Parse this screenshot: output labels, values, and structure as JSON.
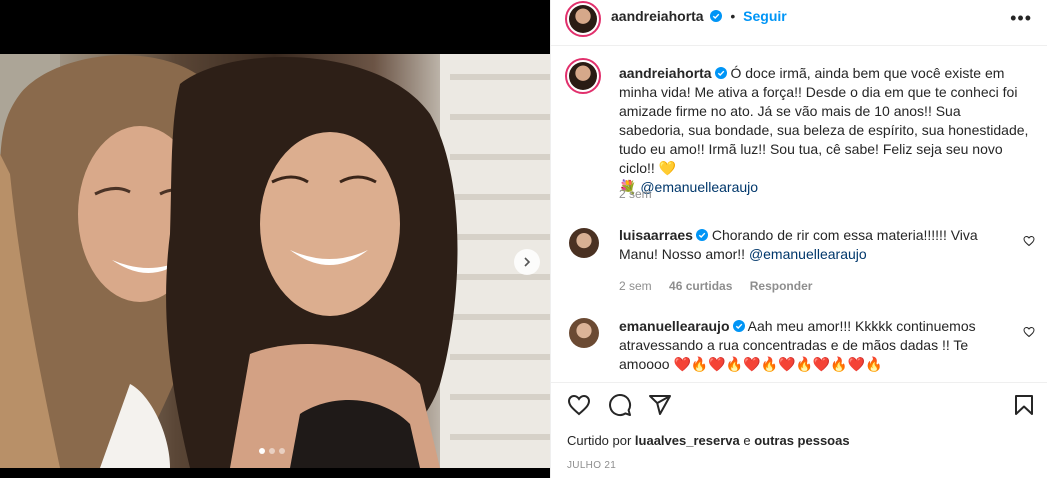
{
  "post": {
    "username": "aandreiahorta",
    "follow_label": "Seguir",
    "separator": "•",
    "more_label": "•••",
    "caption": {
      "username": "aandreiahorta",
      "text": " Ó doce irmã, ainda bem que você existe em minha vida! Me ativa a força!! Desde o dia em que te conheci foi amizade firme no ato. Já se vão mais de 10 anos!! Sua sabedoria, sua bondade, sua beleza de espírito, sua honestidade, tudo eu amo!! Irmã luz!! Sou tua, cê sabe! Feliz seja seu novo ciclo!! 💛",
      "emoji_line": "💐",
      "mention": "@emanuellearaujo",
      "time": "2 sem"
    },
    "comments": [
      {
        "username": "luisaarraes",
        "text": " Chorando de rir com essa materia!!!!!! Viva Manu! Nosso amor!! ",
        "mention": "@emanuellearaujo",
        "time": "2 sem",
        "likes": "46 curtidas",
        "reply": "Responder"
      },
      {
        "username": "emanuellearaujo",
        "text": " Aah meu amor!!! Kkkkk continuemos atravessando a rua concentradas e de mãos dadas !! Te amoooo ❤️🔥❤️🔥❤️🔥❤️🔥❤️🔥❤️🔥"
      }
    ],
    "liked_by": {
      "prefix": "Curtido por ",
      "user": "luaalves_reserva",
      "joiner": " e ",
      "others": "outras pessoas"
    },
    "date": "JULHO 21",
    "carousel": {
      "count": 3,
      "active": 0
    }
  },
  "colors": {
    "follow": "#0095f6",
    "mention": "#00376b",
    "verified": "#0095f6",
    "meta": "#8e8e8e"
  },
  "icons": [
    "verified-icon",
    "heart-icon",
    "comment-icon",
    "share-icon",
    "save-icon",
    "chevron-right-icon",
    "more-icon"
  ]
}
